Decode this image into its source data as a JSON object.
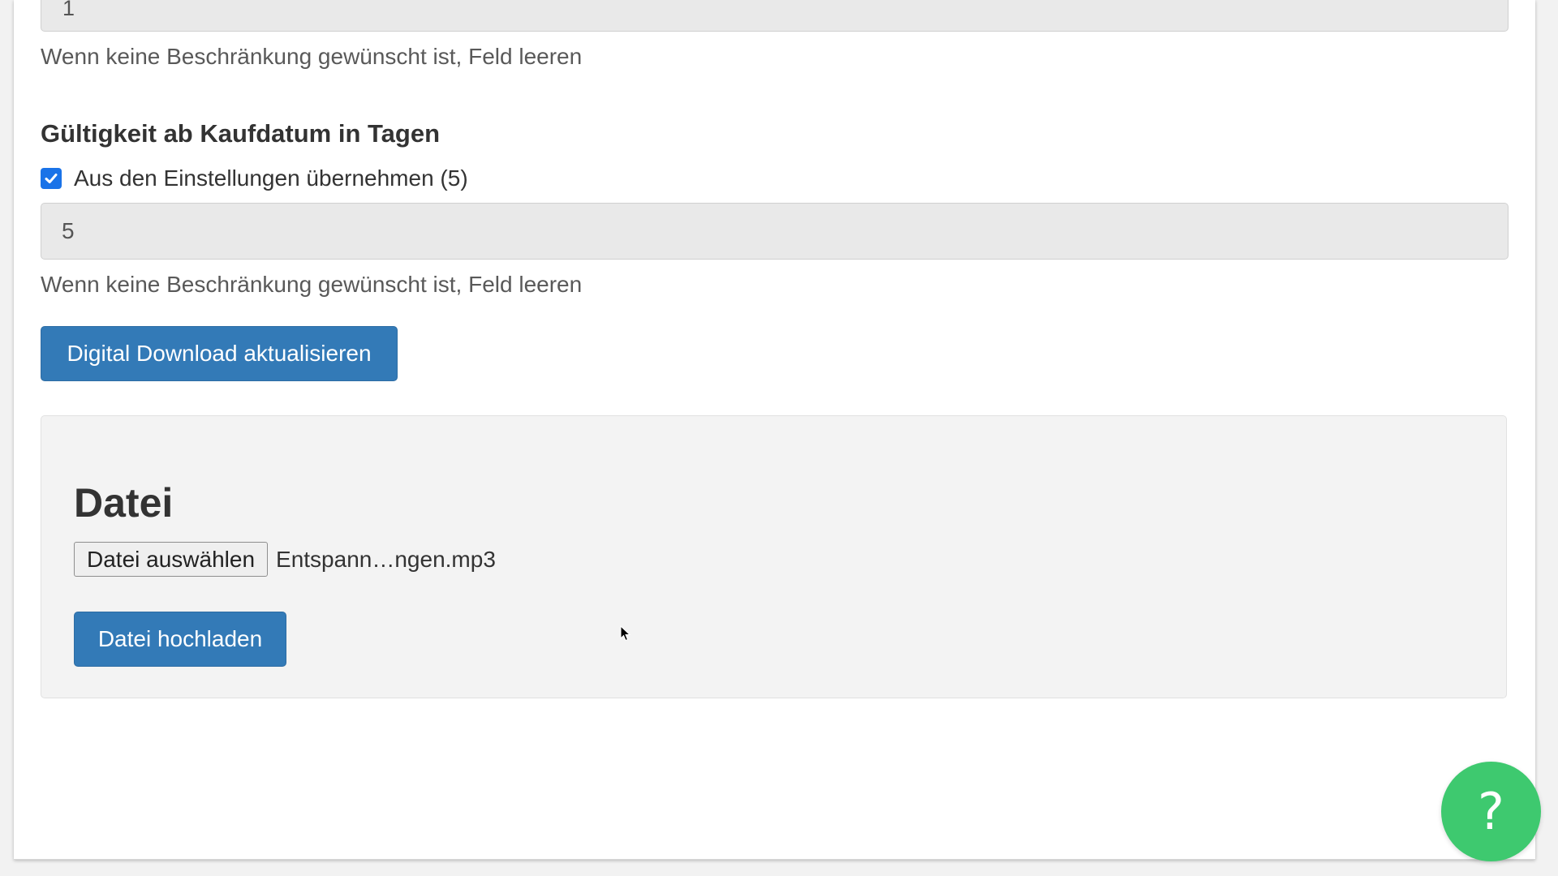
{
  "top_field": {
    "value": "1",
    "help_text": "Wenn keine Beschränkung gewünscht ist, Feld leeren"
  },
  "validity": {
    "title": "Gültigkeit ab Kaufdatum in Tagen",
    "checkbox_label": "Aus den Einstellungen übernehmen (5)",
    "checkbox_checked": true,
    "value": "5",
    "help_text": "Wenn keine Beschränkung gewünscht ist, Feld leeren"
  },
  "update_button_label": "Digital Download aktualisieren",
  "file_section": {
    "title": "Datei",
    "choose_button_label": "Datei auswählen",
    "selected_file": "Entspann…ngen.mp3",
    "upload_button_label": "Datei hochladen"
  },
  "help_fab": {
    "label": "?"
  },
  "colors": {
    "primary": "#337ab7",
    "checkbox": "#1a73e8",
    "help_fab": "#3ec96f"
  },
  "icons": {
    "checkbox": "checkmark-icon",
    "cursor": "mouse-pointer-icon"
  }
}
